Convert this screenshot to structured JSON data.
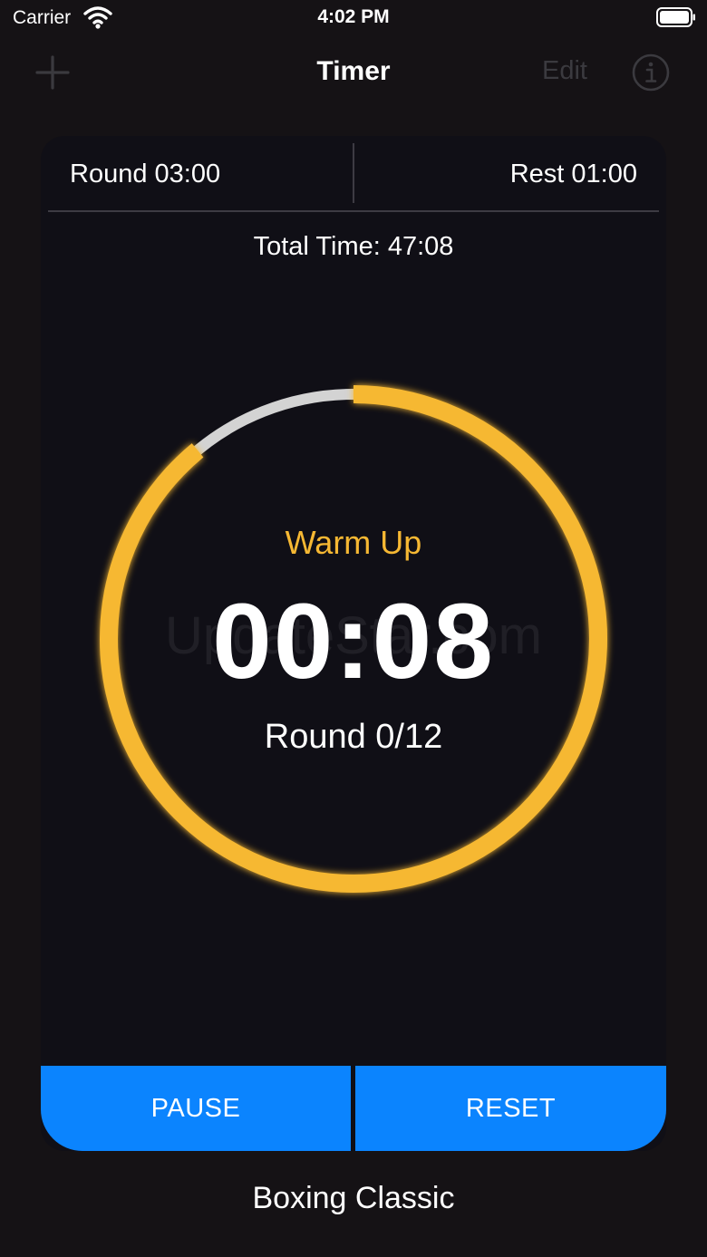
{
  "status_bar": {
    "carrier": "Carrier",
    "time": "4:02 PM"
  },
  "nav": {
    "title": "Timer",
    "edit_label": "Edit",
    "add_icon": "plus-icon",
    "info_icon": "info-icon"
  },
  "intervals": {
    "round": "Round 03:00",
    "rest": "Rest 01:00"
  },
  "total_time": "Total Time: 47:08",
  "timer": {
    "phase": "Warm Up",
    "time": "00:08",
    "round_progress": "Round 0/12",
    "ring_progress": 0.89
  },
  "watermark": "UpdateStar.com",
  "buttons": {
    "pause": "PAUSE",
    "reset": "RESET"
  },
  "preset_name": "Boxing Classic",
  "colors": {
    "accent": "#f6b833",
    "button": "#0b84fe",
    "ring_track": "#d3d3d3",
    "background": "#151215",
    "card": "#100f16"
  }
}
